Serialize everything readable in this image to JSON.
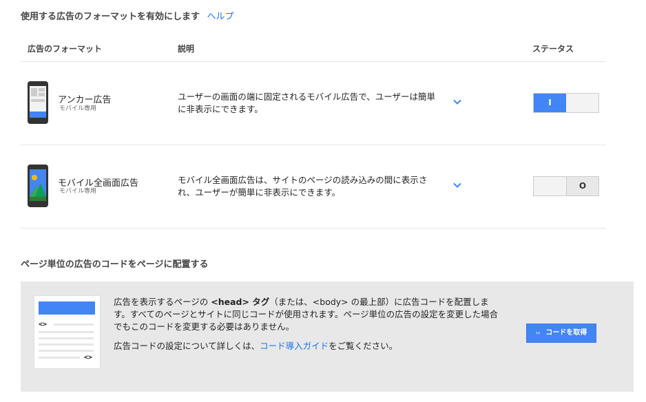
{
  "header": {
    "title": "使用する広告のフォーマットを有効にします",
    "help_link": "ヘルプ"
  },
  "table": {
    "columns": {
      "format": "広告のフォーマット",
      "description": "説明",
      "status": "ステータス"
    },
    "rows": [
      {
        "name": "アンカー広告",
        "subtitle": "モバイル専用",
        "description": "ユーザーの画面の端に固定されるモバイル広告で、ユーザーは簡単に非表示にできます。",
        "toggle_on_label": "I",
        "toggle_off_label": "",
        "enabled": true,
        "icon": "phone-anchor-ad-icon"
      },
      {
        "name": "モバイル全画面広告",
        "subtitle": "モバイル専用",
        "description": "モバイル全画面広告は、サイトのページの読み込みの間に表示され、ユーザーが簡単に非表示にできます。",
        "toggle_on_label": "",
        "toggle_off_label": "O",
        "enabled": false,
        "icon": "phone-fullscreen-ad-icon"
      }
    ]
  },
  "code_section": {
    "heading": "ページ単位の広告のコードをページに配置する",
    "para1_pre": "広告を表示するページの ",
    "para1_bold": "<head> タグ",
    "para1_post": "（または、<body> の最上部）に広告コードを配置します。すべてのページとサイトに同じコードが使用されます。ページ単位の広告の設定を変更した場合でもこのコードを変更する必要はありません。",
    "para2_pre": "広告コードの設定について詳しくは、",
    "para2_link": "コード導入ガイド",
    "para2_post": "をご覧ください。",
    "illustration_code_top": "<>",
    "illustration_code_bottom": "<>",
    "button_arrows": "‹›",
    "button_label": "コードを取得"
  },
  "colors": {
    "accent": "#4285f4",
    "link": "#1a73e8",
    "panel_bg": "#e8e8e8"
  }
}
